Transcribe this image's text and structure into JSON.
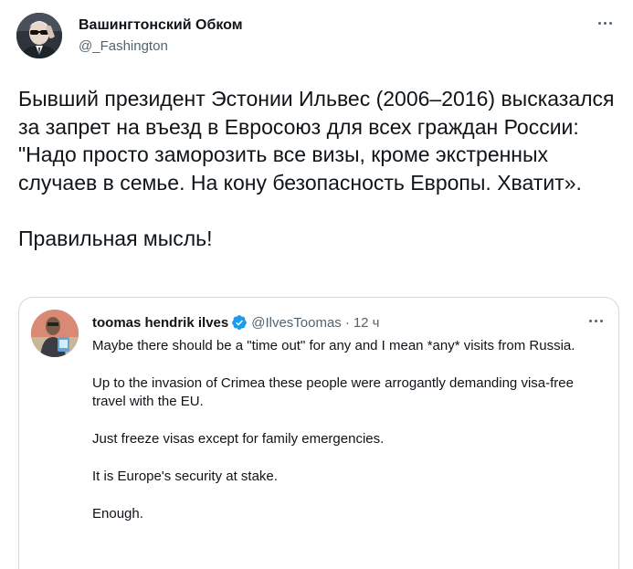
{
  "tweet": {
    "author_name": "Вашингтонский Обком",
    "author_handle": "@_Fashington",
    "text_paragraphs": [
      "Бывший президент Эстонии Ильвес (2006–2016) высказался за запрет на въезд в Евросоюз для всех граждан России: \"Надо просто заморозить все визы, кроме экстренных случаев в семье. На кону безопасность Европы. Хватит».",
      "Правильная мысль!"
    ],
    "more_icon": "more-horizontal-icon"
  },
  "quoted_tweet": {
    "author_name": "toomas hendrik ilves",
    "author_handle": "@IlvesToomas",
    "separator": "·",
    "time": "12 ч",
    "verified_icon": "verified-badge-icon",
    "verified_color": "#1d9bf0",
    "paragraphs": [
      "Maybe there should be a \"time out\" for any and I mean *any* visits from Russia.",
      "Up to the invasion of Crimea these people were arrogantly demanding visa-free travel with the EU.",
      "Just freeze visas except for family emergencies.",
      "It is Europe's security at stake.",
      "Enough."
    ]
  },
  "colors": {
    "primary_text": "#0f1419",
    "secondary_text": "#536471",
    "border": "#cfd9de",
    "accent": "#1d9bf0"
  }
}
